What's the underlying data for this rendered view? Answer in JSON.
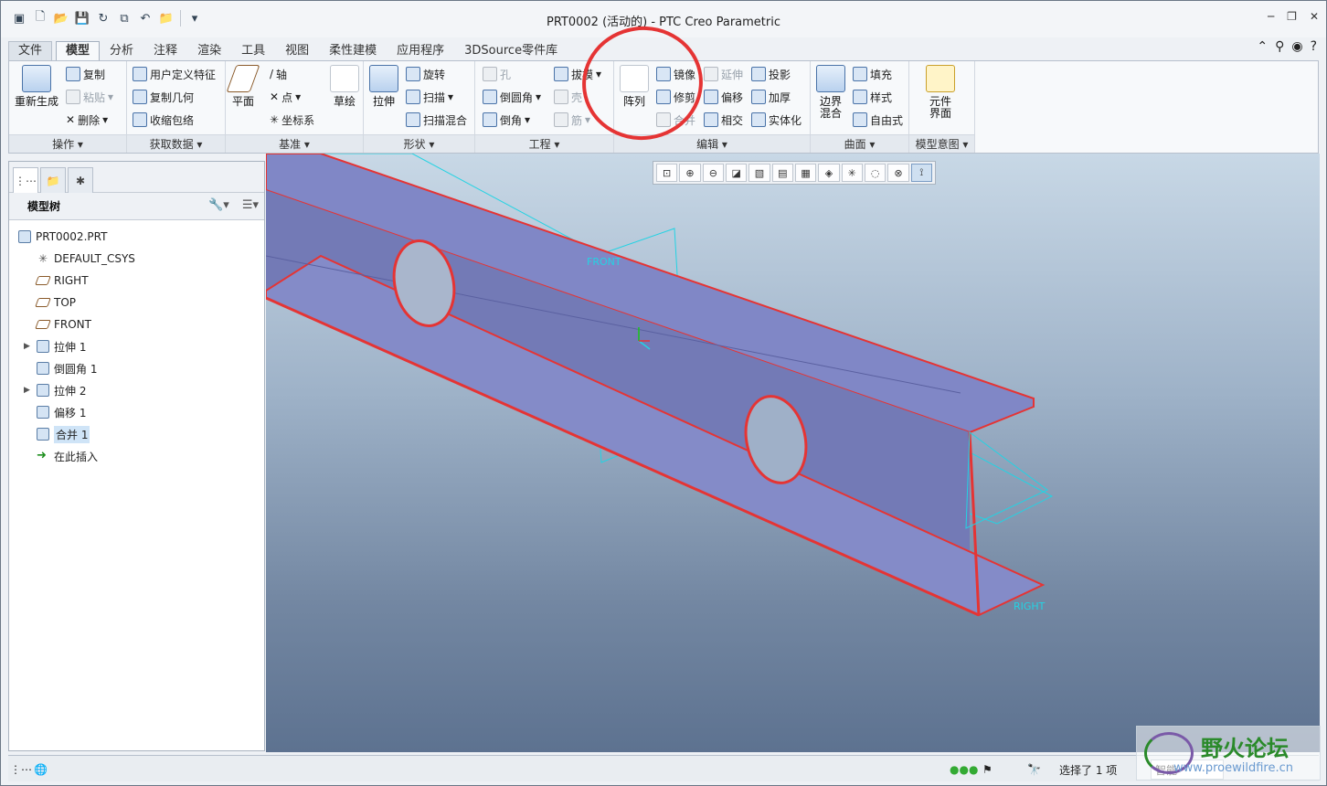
{
  "window": {
    "title": "PRT0002 (活动的) - PTC Creo Parametric"
  },
  "tabs": [
    "文件",
    "模型",
    "分析",
    "注释",
    "渲染",
    "工具",
    "视图",
    "柔性建模",
    "应用程序",
    "3DSource零件库"
  ],
  "active_tab": "模型",
  "ribbon": {
    "operations": {
      "regen": "重新生成",
      "copy": "复制",
      "paste": "粘贴",
      "delete": "删除",
      "label": "操作"
    },
    "get_data": {
      "udf": "用户定义特征",
      "copy_geom": "复制几何",
      "shrinkwrap": "收缩包络",
      "label": "获取数据"
    },
    "datum": {
      "plane": "平面",
      "axis": "轴",
      "point": "点",
      "csys": "坐标系",
      "sketch": "草绘",
      "label": "基准"
    },
    "shapes": {
      "extrude": "拉伸",
      "revolve": "旋转",
      "sweep": "扫描",
      "swept_blend": "扫描混合",
      "label": "形状"
    },
    "engineering": {
      "hole": "孔",
      "round": "倒圆角",
      "chamfer": "倒角",
      "draft": "拔模",
      "shell": "壳",
      "rib": "筋",
      "label": "工程"
    },
    "editing": {
      "pattern": "阵列",
      "mirror": "镜像",
      "trim": "修剪",
      "merge": "合并",
      "extend": "延伸",
      "offset": "偏移",
      "intersect": "相交",
      "project": "投影",
      "thicken": "加厚",
      "solidify": "实体化",
      "label": "编辑"
    },
    "surfaces": {
      "boundary": "边界混合",
      "fill": "填充",
      "style": "样式",
      "freestyle": "自由式",
      "label": "曲面"
    },
    "intent": {
      "component": "元件界面",
      "label": "模型意图"
    }
  },
  "tree": {
    "header": "模型树",
    "items": [
      {
        "label": "PRT0002.PRT",
        "type": "part"
      },
      {
        "label": "DEFAULT_CSYS",
        "type": "csys"
      },
      {
        "label": "RIGHT",
        "type": "plane"
      },
      {
        "label": "TOP",
        "type": "plane"
      },
      {
        "label": "FRONT",
        "type": "plane"
      },
      {
        "label": "拉伸 1",
        "type": "feature",
        "expandable": true
      },
      {
        "label": "倒圆角 1",
        "type": "feature"
      },
      {
        "label": "拉伸 2",
        "type": "feature",
        "expandable": true
      },
      {
        "label": "偏移 1",
        "type": "feature"
      },
      {
        "label": "合并 1",
        "type": "feature",
        "selected": true
      },
      {
        "label": "在此插入",
        "type": "insert"
      }
    ]
  },
  "viewport": {
    "labels": {
      "front": "FRONT",
      "right": "RIGHT"
    }
  },
  "status": {
    "selected": "选择了 1 项",
    "filter": "智能"
  },
  "watermark": {
    "line1": "野火论坛",
    "line2": "www.proewildfire.cn"
  },
  "colors": {
    "edge": "#e53434",
    "datum": "#23d3e3",
    "body": "#7a80c0"
  }
}
